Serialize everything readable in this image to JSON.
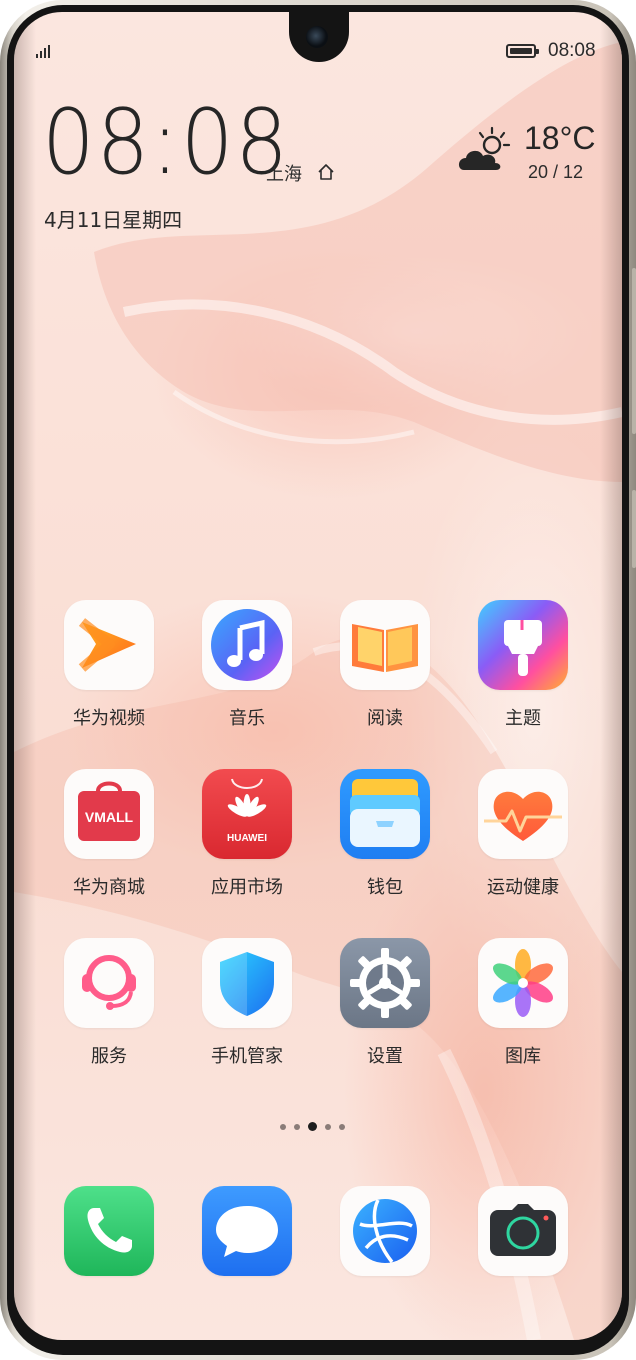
{
  "status_bar": {
    "time": "08:08",
    "signal_icon": "signal-icon",
    "battery_icon": "battery-icon"
  },
  "clock_widget": {
    "time": "08:08",
    "city": "上海",
    "home_icon": "home-icon",
    "date": "4月11日星期四"
  },
  "weather": {
    "icon": "partly-cloudy-icon",
    "temperature": "18°C",
    "range": "20 / 12"
  },
  "apps": [
    {
      "label": "华为视频",
      "icon": "huawei-video-icon"
    },
    {
      "label": "音乐",
      "icon": "music-icon"
    },
    {
      "label": "阅读",
      "icon": "reading-icon"
    },
    {
      "label": "主题",
      "icon": "themes-icon"
    },
    {
      "label": "华为商城",
      "icon": "vmall-icon",
      "badge_text": "VMALL"
    },
    {
      "label": "应用市场",
      "icon": "app-gallery-icon",
      "badge_text": "HUAWEI"
    },
    {
      "label": "钱包",
      "icon": "wallet-icon"
    },
    {
      "label": "运动健康",
      "icon": "health-icon"
    },
    {
      "label": "服务",
      "icon": "service-icon"
    },
    {
      "label": "手机管家",
      "icon": "phone-manager-icon"
    },
    {
      "label": "设置",
      "icon": "settings-icon"
    },
    {
      "label": "图库",
      "icon": "gallery-icon"
    }
  ],
  "page_indicator": {
    "count": 5,
    "active_index": 2
  },
  "dock": [
    {
      "icon": "phone-icon"
    },
    {
      "icon": "messages-icon"
    },
    {
      "icon": "browser-icon"
    },
    {
      "icon": "camera-icon"
    }
  ],
  "colors": {
    "wallpaper": "#fbe1d8",
    "text": "#2a2a2a",
    "phone_green": "#2fc46a",
    "messages_blue": "#1e7cf0",
    "app_gallery_red": "#e8313a"
  }
}
